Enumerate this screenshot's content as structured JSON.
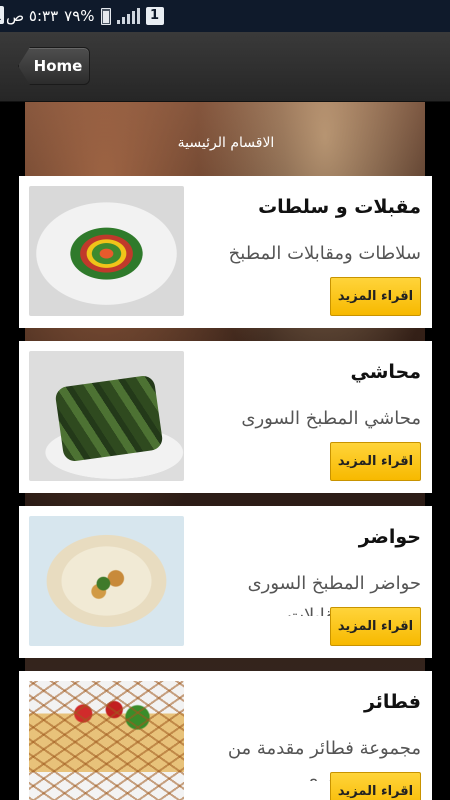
{
  "status_bar": {
    "time": "٥:٣٣ ص",
    "battery_percent": "٧٩%",
    "notification_count": "1"
  },
  "action_bar": {
    "home_label": "Home"
  },
  "hero": {
    "title": "الاقسام الرئيسية"
  },
  "categories": [
    {
      "title": "مقبلات و سلطات",
      "description": "سلاطات ومقابلات المطبخ",
      "button_label": "اقراء المزيد",
      "image": "salad-platter"
    },
    {
      "title": "محاشي",
      "description": "محاشي المطبخ السورى",
      "button_label": "اقراء المزيد",
      "image": "stuffed-grape-leaves"
    },
    {
      "title": "حواضر",
      "description": "حواضر المطبخ السورى سلاطات ومقابلات",
      "button_label": "اقراء المزيد",
      "image": "hummus-plate"
    },
    {
      "title": "فطائر",
      "description": "مجموعة فطائر مقدمة من المطبخ السوري",
      "button_label": "اقراء المزيد",
      "image": "lattice-pie"
    }
  ]
}
